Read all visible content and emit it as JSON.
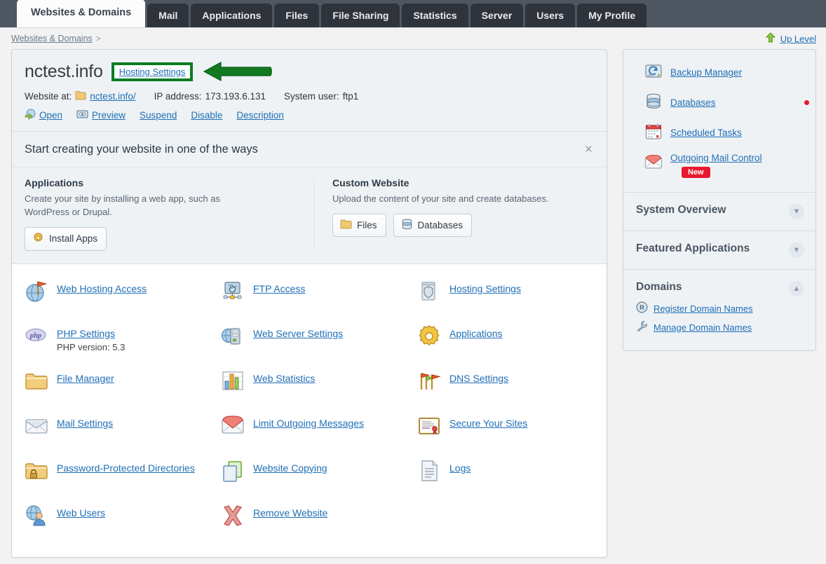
{
  "tabs": [
    {
      "label": "Websites & Domains",
      "active": true
    },
    {
      "label": "Mail",
      "active": false
    },
    {
      "label": "Applications",
      "active": false
    },
    {
      "label": "Files",
      "active": false
    },
    {
      "label": "File Sharing",
      "active": false
    },
    {
      "label": "Statistics",
      "active": false
    },
    {
      "label": "Server",
      "active": false
    },
    {
      "label": "Users",
      "active": false
    },
    {
      "label": "My Profile",
      "active": false
    }
  ],
  "breadcrumb": {
    "link": "Websites & Domains",
    "separator": ">"
  },
  "up_level": {
    "label": "Up Level",
    "icon": "up-arrow-icon"
  },
  "domain": {
    "name": "nctest.info",
    "hosting_settings_link": "Hosting Settings",
    "website_at_label": "Website at:",
    "website_at_value": "nctest.info/",
    "ip_label": "IP address:",
    "ip_value": "173.193.6.131",
    "system_user_label": "System user:",
    "system_user_value": "ftp1",
    "actions": [
      {
        "label": "Open",
        "icon": "open-globe-icon"
      },
      {
        "label": "Preview",
        "icon": "preview-icon"
      },
      {
        "label": "Suspend",
        "icon": null
      },
      {
        "label": "Disable",
        "icon": null
      },
      {
        "label": "Description",
        "icon": null
      }
    ]
  },
  "promo": {
    "title": "Start creating your website in one of the ways",
    "close_label": "×",
    "applications": {
      "heading": "Applications",
      "text": "Create your site by installing a web app, such as WordPress or Drupal.",
      "button": "Install Apps"
    },
    "custom": {
      "heading": "Custom Website",
      "text": "Upload the content of your site and create databases.",
      "buttons": [
        "Files",
        "Databases"
      ]
    }
  },
  "grid": [
    {
      "label": "Web Hosting Access",
      "icon": "globe-flag-icon",
      "sub": null
    },
    {
      "label": "FTP Access",
      "icon": "ftp-icon",
      "sub": null
    },
    {
      "label": "Hosting Settings",
      "icon": "hosting-shield-icon",
      "sub": null
    },
    {
      "label": "PHP Settings",
      "icon": "php-icon",
      "sub": "PHP version: 5.3"
    },
    {
      "label": "Web Server Settings",
      "icon": "web-server-icon",
      "sub": null
    },
    {
      "label": "Applications",
      "icon": "gear-icon",
      "sub": null
    },
    {
      "label": "File Manager",
      "icon": "folder-icon",
      "sub": null
    },
    {
      "label": "Web Statistics",
      "icon": "bar-chart-icon",
      "sub": null
    },
    {
      "label": "DNS Settings",
      "icon": "flags-icon",
      "sub": null
    },
    {
      "label": "Mail Settings",
      "icon": "envelope-icon",
      "sub": null
    },
    {
      "label": "Limit Outgoing Messages",
      "icon": "envelope-red-icon",
      "sub": null
    },
    {
      "label": "Secure Your Sites",
      "icon": "certificate-icon",
      "sub": null
    },
    {
      "label": "Password-Protected Directories",
      "icon": "folder-lock-icon",
      "sub": null
    },
    {
      "label": "Website Copying",
      "icon": "copy-pages-icon",
      "sub": null
    },
    {
      "label": "Logs",
      "icon": "document-lines-icon",
      "sub": null
    },
    {
      "label": "Web Users",
      "icon": "user-globe-icon",
      "sub": null
    },
    {
      "label": "Remove Website",
      "icon": "red-x-icon",
      "sub": null
    },
    {
      "label": "",
      "icon": null,
      "sub": null
    }
  ],
  "sidebar": {
    "tools": [
      {
        "label": "Backup Manager",
        "icon": "backup-drive-icon",
        "badge": null
      },
      {
        "label": "Databases",
        "icon": "database-icon",
        "badge": null
      },
      {
        "label": "Scheduled Tasks",
        "icon": "calendar-icon",
        "badge": null
      },
      {
        "label": "Outgoing Mail Control",
        "icon": "mail-red-icon",
        "badge": "New"
      }
    ],
    "sections": [
      {
        "title": "System Overview",
        "expanded": false,
        "chevron": "chevron-down-icon"
      },
      {
        "title": "Featured Applications",
        "expanded": false,
        "chevron": "chevron-down-icon"
      },
      {
        "title": "Domains",
        "expanded": true,
        "chevron": "chevron-up-icon",
        "links": [
          {
            "label": "Register Domain Names",
            "icon": "registered-r-icon"
          },
          {
            "label": "Manage Domain Names",
            "icon": "wrench-icon"
          }
        ]
      }
    ]
  },
  "annotation": {
    "highlight_color": "#0a7d22",
    "arrow_color": "#117a1f",
    "target": "Hosting Settings"
  },
  "colors": {
    "tabbar_bg": "#4e5662",
    "tab_bg": "#2f343c",
    "link": "#1f6eb5",
    "panel_bg": "#ffffff",
    "panel_header_bg": "#eef2f5",
    "page_bg": "#f2f2f2",
    "badge_red": "#e8192c"
  }
}
